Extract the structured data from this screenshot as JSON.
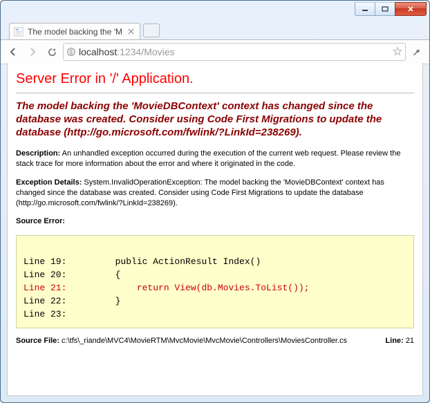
{
  "window": {
    "tab_title": "The model backing the 'M"
  },
  "toolbar": {
    "url_host": "localhost",
    "url_rest": ":1234/Movies"
  },
  "error": {
    "title": "Server Error in '/' Application.",
    "subtitle": "The model backing the 'MovieDBContext' context has changed since the database was created. Consider using Code First Migrations to update the database (http://go.microsoft.com/fwlink/?LinkId=238269).",
    "description_label": "Description:",
    "description_text": " An unhandled exception occurred during the execution of the current web request. Please review the stack trace for more information about the error and where it originated in the code.",
    "exception_label": "Exception Details:",
    "exception_text": " System.InvalidOperationException: The model backing the 'MovieDBContext' context has changed since the database was created. Consider using Code First Migrations to update the database (http://go.microsoft.com/fwlink/?LinkId=238269).",
    "source_error_label": "Source Error:",
    "code": {
      "l19": "Line 19:         public ActionResult Index()",
      "l20": "Line 20:         {",
      "l21": "Line 21:             return View(db.Movies.ToList());",
      "l22": "Line 22:         }",
      "l23": "Line 23:"
    },
    "source_file_label": "Source File:",
    "source_file_path": " c:\\tfs\\_riande\\MVC4\\MovieRTM\\MvcMovie\\MvcMovie\\Controllers\\MoviesController.cs",
    "line_label": "Line:",
    "line_number": " 21"
  }
}
